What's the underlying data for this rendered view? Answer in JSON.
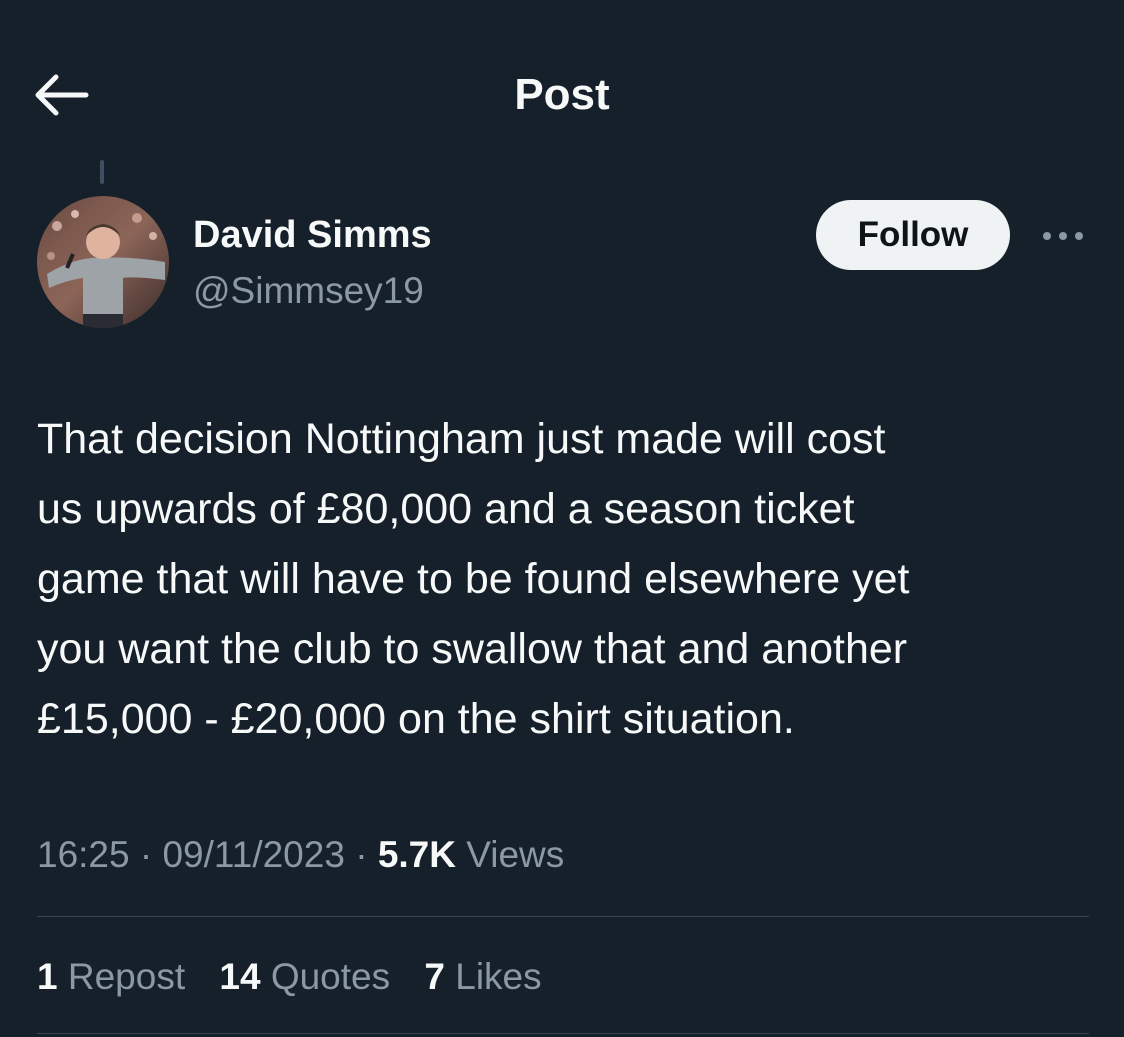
{
  "header": {
    "title": "Post",
    "back_icon": "arrow-left-icon"
  },
  "author": {
    "display_name": "David Simms",
    "handle": "@Simmsey19",
    "follow_label": "Follow",
    "more_icon": "more-horizontal-icon"
  },
  "tweet": {
    "lines": [
      "That decision Nottingham just made will cost",
      "us upwards of £80,000 and a season ticket",
      "game that will have to be found elsewhere yet",
      "you want the club to swallow that and another",
      "£15,000 - £20,000 on the shirt situation."
    ]
  },
  "meta": {
    "time": "16:25",
    "separator": "·",
    "date": "09/11/2023",
    "views_count": "5.7K",
    "views_label": "Views"
  },
  "stats": {
    "reposts_count": "1",
    "reposts_label": "Repost",
    "quotes_count": "14",
    "quotes_label": "Quotes",
    "likes_count": "7",
    "likes_label": "Likes"
  },
  "colors": {
    "background": "#15202b",
    "text_primary": "#f7f9f9",
    "text_secondary": "#8b98a5",
    "follow_button_bg": "#eff3f4",
    "divider": "#38444d"
  }
}
